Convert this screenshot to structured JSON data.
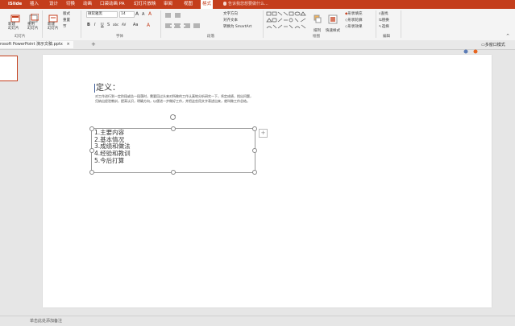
{
  "menubar": {
    "items": [
      "iSlide",
      "插入",
      "设计",
      "切换",
      "动画",
      "口袋动画 PA",
      "幻灯片放映",
      "审阅",
      "视图",
      "格式"
    ],
    "active": "格式",
    "tell_me": "告诉我您想要做什么..."
  },
  "ribbon": {
    "slides_group": {
      "new_slide": "新建\n幻灯片",
      "reuse": "重用\n幻灯片",
      "new_section": "新建\n幻灯片",
      "label": "幻灯片"
    },
    "section_label": "节",
    "format_small": [
      "版式",
      "重置",
      "节"
    ],
    "font_group": {
      "font_name": "微软雅黑",
      "font_size": "14",
      "bold": "B",
      "italic": "I",
      "underline": "U",
      "strike": "S",
      "shadow": "abc",
      "spacing": "AV",
      "case": "Aa",
      "label": "字体"
    },
    "paragraph_group": {
      "text_direction": "文字方向",
      "align_text": "对齐文本",
      "smartart": "转换为 SmartArt",
      "label": "段落"
    },
    "drawing_group": {
      "arrange": "排列",
      "quick_styles": "快速样式",
      "label": "绘图"
    },
    "shape_group": {
      "fill": "形状填充",
      "outline": "形状轮廓",
      "effects": "形状效果"
    },
    "editing_group": {
      "find": "查找",
      "replace": "替换",
      "select": "选择",
      "label": "编辑"
    },
    "new_slide_label": "新建\n幻灯片",
    "group_labels": {
      "drawing": "绘图",
      "editing": "编辑"
    }
  },
  "tab": {
    "document": "rosoft PowerPoint 演示文稿.pptx",
    "close": "×",
    "add": "+",
    "multi_window": "多窗口模式"
  },
  "slide": {
    "title": "定义：",
    "body_line1": "对工作进行到一定阶段或告一段落时，需要回过头来对所做的工作认真地分析研究一下，肯定成绩，找出问题，",
    "body_line2": "归纳出经验教训，提高认识，明确方向，以便进一步做好工作，并把这些用文字表述出来，就叫做工作总结。",
    "list": [
      "1.主要内容",
      "2.基本情况",
      "3.成绩和做法",
      "4.经验和教训",
      "5.今后打算"
    ]
  },
  "status": {
    "notes": "单击此处添加备注"
  }
}
